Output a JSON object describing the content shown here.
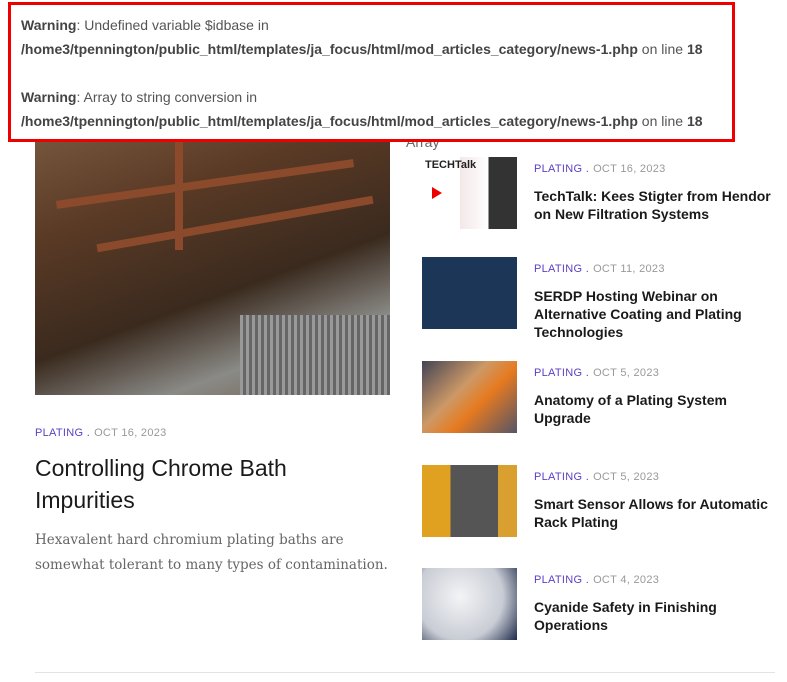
{
  "warnings": [
    {
      "label": "Warning",
      "message": ": Undefined variable $idbase in",
      "path": "/home3/tpennington/public_html/templates/ja_focus/html/mod_articles_category/news-1.php",
      "on_line": " on line ",
      "line": "18"
    },
    {
      "label": "Warning",
      "message": ": Array to string conversion in",
      "path": "/home3/tpennington/public_html/templates/ja_focus/html/mod_articles_category/news-1.php",
      "on_line": " on line ",
      "line": "18"
    }
  ],
  "array_text": "Array",
  "featured": {
    "category": "PLATING .",
    "date": "OCT 16, 2023",
    "title": "Controlling Chrome Bath Impurities",
    "description": "Hexavalent hard chromium plating baths are somewhat tolerant to many types of contamination."
  },
  "articles": [
    {
      "category": "PLATING .",
      "date": "OCT 16, 2023",
      "title": "TechTalk: Kees Stigter from Hendor on New Filtration Systems"
    },
    {
      "category": "PLATING .",
      "date": "OCT 11, 2023",
      "title": "SERDP Hosting Webinar on Alternative Coating and Plating Technologies"
    },
    {
      "category": "PLATING .",
      "date": "OCT 5, 2023",
      "title": "Anatomy of a Plating System Upgrade"
    },
    {
      "category": "PLATING .",
      "date": "OCT 5, 2023",
      "title": "Smart Sensor Allows for Automatic Rack Plating"
    },
    {
      "category": "PLATING .",
      "date": "OCT 4, 2023",
      "title": "Cyanide Safety in Finishing Operations"
    }
  ],
  "thumb_logo": "TECHTalk"
}
